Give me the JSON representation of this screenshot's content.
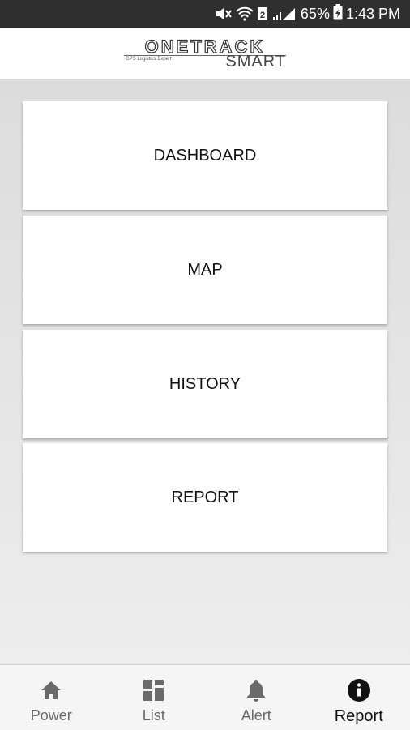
{
  "status_bar": {
    "battery_percent": "65%",
    "time": "1:43 PM",
    "icons": [
      "mute-icon",
      "wifi-icon",
      "sim-2-icon",
      "signal-icon",
      "battery-icon"
    ]
  },
  "header": {
    "brand": "ONETRACK",
    "tagline": "GPS Logistics Expert",
    "sub_brand": "SMART"
  },
  "menu": {
    "items": [
      {
        "label": "DASHBOARD"
      },
      {
        "label": "MAP"
      },
      {
        "label": "HISTORY"
      },
      {
        "label": "REPORT"
      }
    ]
  },
  "bottom_nav": {
    "items": [
      {
        "label": "Power",
        "icon": "home-icon",
        "active": false
      },
      {
        "label": "List",
        "icon": "grid-icon",
        "active": false
      },
      {
        "label": "Alert",
        "icon": "bell-icon",
        "active": false
      },
      {
        "label": "Report",
        "icon": "info-icon",
        "active": true
      }
    ]
  },
  "colors": {
    "status_bar": "#2f2f2f",
    "header_bg": "#ffffff",
    "content_bg": "#e6e6e6",
    "card_bg": "#ffffff",
    "nav_bg": "#f5f5f5",
    "nav_inactive": "#6a6a6a",
    "nav_active": "#111111"
  }
}
